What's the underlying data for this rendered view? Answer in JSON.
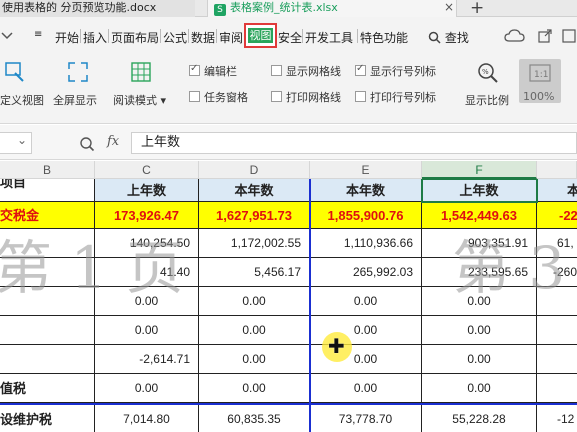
{
  "tabs": [
    {
      "title": "使用表格的 分页预览功能.docx"
    },
    {
      "title": "表格案例_统计表.xlsx",
      "icon": "S"
    }
  ],
  "tab_close": "×",
  "tab_add": "+",
  "menu": [
    "开始",
    "插入",
    "页面布局",
    "公式",
    "数据",
    "审阅",
    "视图",
    "安全",
    "开发工具",
    "特色功能"
  ],
  "search_label": "查找",
  "ribbon": {
    "buttons": [
      "定义视图",
      "全屏显示",
      "阅读模式",
      "显示比例",
      "100%"
    ],
    "checks": [
      {
        "label": "编辑栏",
        "checked": true
      },
      {
        "label": "显示网格线",
        "checked": false
      },
      {
        "label": "显示行号列标",
        "checked": true
      },
      {
        "label": "任务窗格",
        "checked": false
      },
      {
        "label": "打印网格线",
        "checked": false
      },
      {
        "label": "打印行号列标",
        "checked": false
      }
    ]
  },
  "formula": {
    "fx": "fx",
    "value": "上年数"
  },
  "columns": [
    "B",
    "C",
    "D",
    "E",
    "F"
  ],
  "rows": [
    [
      "项目",
      "上年数",
      "本年数",
      "本年数",
      "上年数",
      "本"
    ],
    [
      "交税金",
      "173,926.47",
      "1,627,951.73",
      "1,855,900.76",
      "1,542,449.63",
      "-227"
    ],
    [
      "",
      "140,254.50",
      "1,172,002.55",
      "1,110,936.66",
      "903,351.91",
      "61,"
    ],
    [
      "",
      "41.40",
      "5,456.17",
      "265,992.03",
      "233,595.65",
      "-260"
    ],
    [
      "",
      "0.00",
      "0.00",
      "0.00",
      "0.00",
      ""
    ],
    [
      "",
      "0.00",
      "0.00",
      "0.00",
      "0.00",
      ""
    ],
    [
      "",
      "-2,614.71",
      "0.00",
      "0.00",
      "0.00",
      ""
    ],
    [
      "值税",
      "0.00",
      "0.00",
      "0.00",
      "0.00",
      ""
    ],
    [
      "设维护税",
      "7,014.80",
      "60,835.35",
      "73,778.70",
      "55,228.28",
      "-12"
    ]
  ],
  "page_marks": [
    "第 1 页",
    "第 3"
  ],
  "colors": {
    "accent": "#2aa45b",
    "highlight": "#ffff00",
    "negative": "#e01010",
    "page_break": "#1a2fd1"
  }
}
